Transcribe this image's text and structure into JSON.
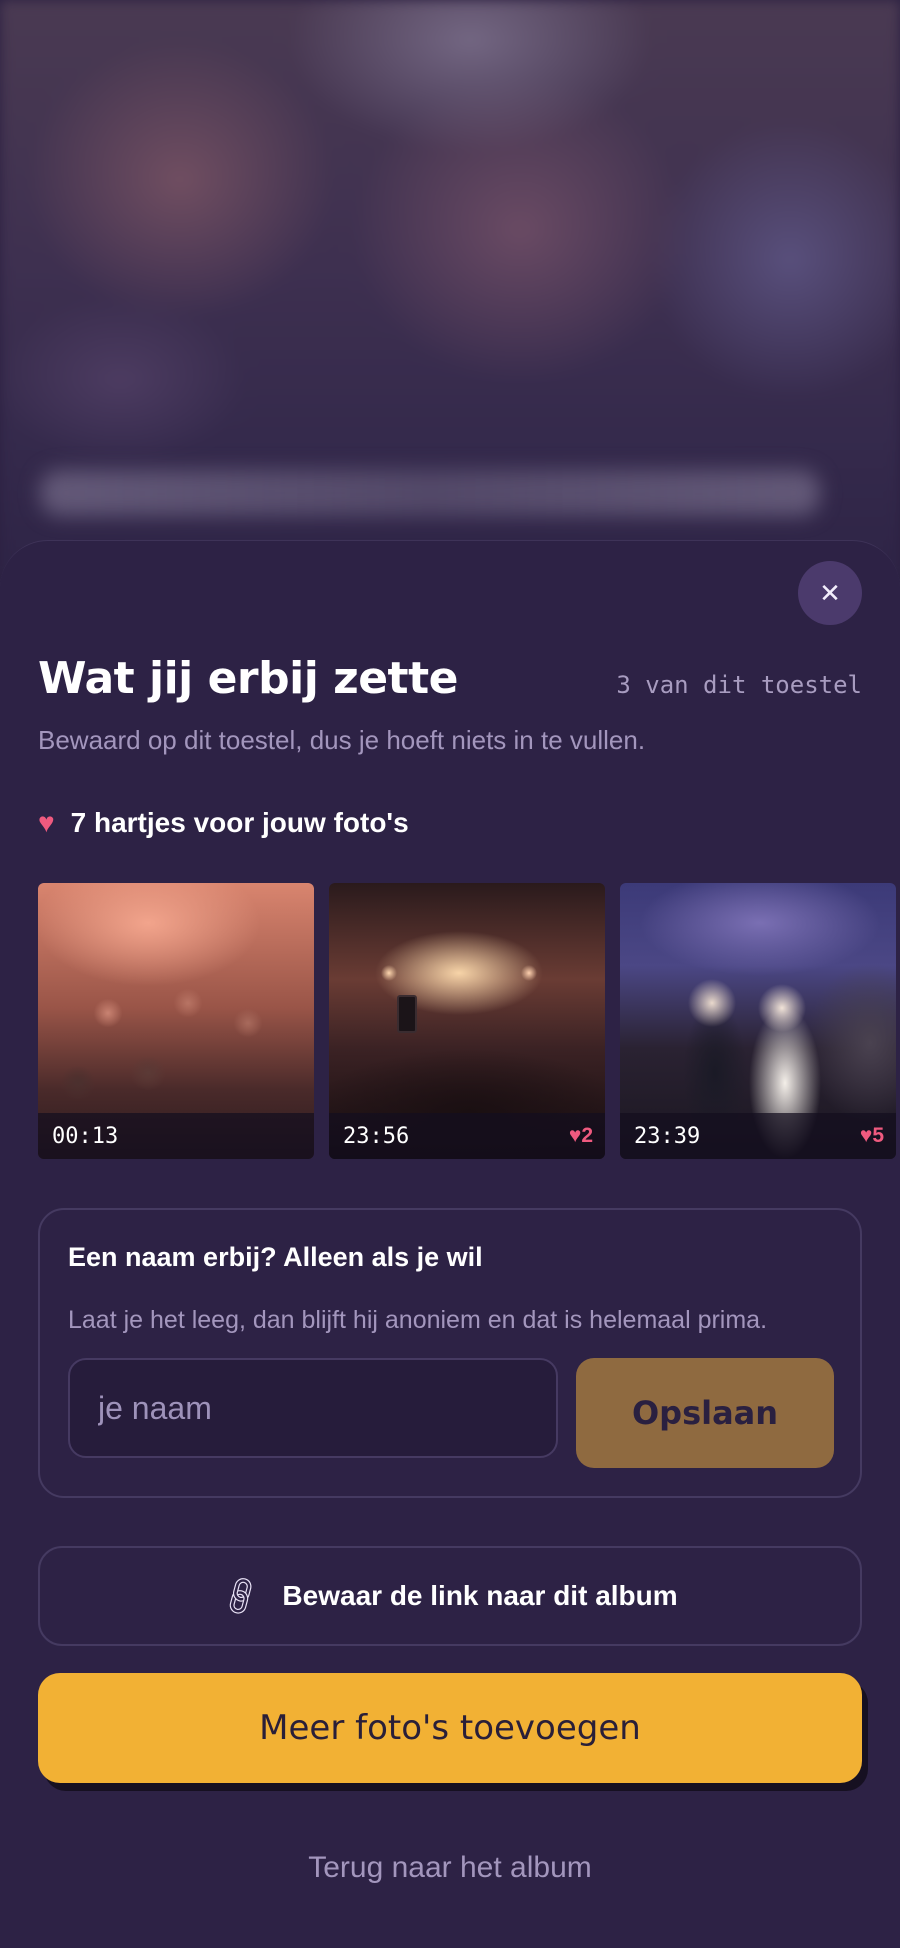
{
  "sheet": {
    "close_icon": "close-icon",
    "title": "Wat jij erbij zette",
    "device_count": "3 van dit toestel",
    "subtitle": "Bewaard op dit toestel, dus je hoeft niets in te vullen.",
    "hearts_label": "7 hartjes voor jouw foto's",
    "heart_color": "#ef5a7f"
  },
  "photos": [
    {
      "time": "00:13",
      "likes": ""
    },
    {
      "time": "23:56",
      "likes": "♥2"
    },
    {
      "time": "23:39",
      "likes": "♥5"
    }
  ],
  "name_card": {
    "title": "Een naam erbij? Alleen als je wil",
    "description": "Laat je het leeg, dan blijft hij anoniem en dat is helemaal prima.",
    "input_placeholder": "je naam",
    "input_value": "",
    "save_label": "Opslaan"
  },
  "actions": {
    "link_label": "Bewaar de link naar dit album",
    "primary_label": "Meer foto's toevoegen",
    "back_label": "Terug naar het album"
  },
  "colors": {
    "background": "#2d2245",
    "accent": "#f2b134",
    "save_button": "#8f6a40",
    "muted_text": "#a396bd"
  }
}
